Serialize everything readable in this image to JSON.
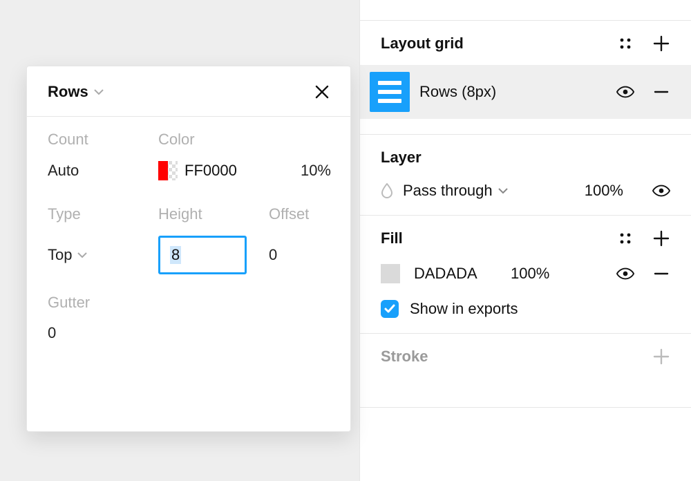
{
  "popover": {
    "title": "Rows",
    "count": {
      "label": "Count",
      "value": "Auto"
    },
    "color": {
      "label": "Color",
      "hex": "FF0000",
      "opacity": "10%"
    },
    "type": {
      "label": "Type",
      "value": "Top"
    },
    "height": {
      "label": "Height",
      "value": "8"
    },
    "offset": {
      "label": "Offset",
      "value": "0"
    },
    "gutter": {
      "label": "Gutter",
      "value": "0"
    }
  },
  "inspector": {
    "layout_grid": {
      "title": "Layout grid",
      "row_label": "Rows (8px)"
    },
    "layer": {
      "title": "Layer",
      "mode": "Pass through",
      "opacity": "100%"
    },
    "fill": {
      "title": "Fill",
      "hex": "DADADA",
      "opacity": "100%",
      "show_exports_label": "Show in exports"
    },
    "stroke": {
      "title": "Stroke"
    }
  }
}
